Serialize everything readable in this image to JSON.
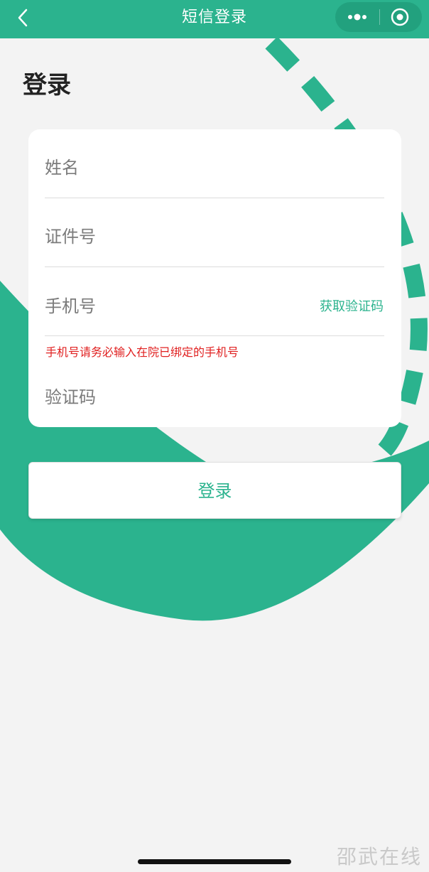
{
  "nav": {
    "title": "短信登录",
    "back_icon": "chevron-left-icon",
    "more_icon": "more-dots-icon",
    "close_icon": "target-circle-icon",
    "bg_color": "#2bb38e"
  },
  "page": {
    "heading": "登录"
  },
  "form": {
    "name_placeholder": "姓名",
    "id_placeholder": "证件号",
    "phone_placeholder": "手机号",
    "get_code_label": "获取验证码",
    "phone_hint": "手机号请务必输入在院已绑定的手机号",
    "code_placeholder": "验证码"
  },
  "login_button": {
    "label": "登录"
  },
  "footer": {
    "watermark": "邵武在线"
  },
  "colors": {
    "accent": "#2bb38e",
    "error": "#e02020",
    "background": "#f3f3f3"
  }
}
